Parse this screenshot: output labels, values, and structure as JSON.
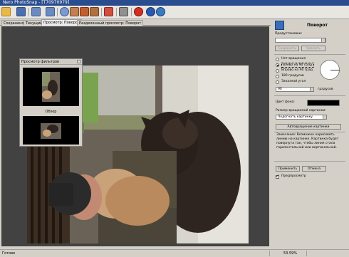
{
  "window": {
    "title": "Nero PhotoSnap - [T70970979]"
  },
  "tabs": [
    {
      "label": "Сохранено"
    },
    {
      "label": "Текущий"
    },
    {
      "label": "Просмотр: Поворот"
    },
    {
      "label": "Разделенный просмотр: Поворот"
    }
  ],
  "preview": {
    "title": "Просмотр фильтров",
    "caption": "Обзор"
  },
  "panel": {
    "title": "Поворот",
    "presets_label": "Предустановки:",
    "save_label": "Сохранить",
    "delete_label": "Удалить",
    "radios": [
      {
        "label": "Нет вращения",
        "selected": false
      },
      {
        "label": "Влево на 90 град.",
        "selected": true
      },
      {
        "label": "Вправо на 90 град.",
        "selected": false
      },
      {
        "label": "180 градусов",
        "selected": false
      },
      {
        "label": "Заказной угол",
        "selected": false
      }
    ],
    "angle_value": "90",
    "angle_unit": "градусов",
    "bg_color_label": "Цвет фона:",
    "bg_color": "#000000",
    "size_label": "Размер вращаемой картинки:",
    "size_value": "Подогнать картинку",
    "auto_label": "Автовращение картинки",
    "note": "Замечание: Возможно нарисовать линию на картинке. Картинка будет повернута так, чтобы линия стала горизонтальной или вертикальной.",
    "apply_label": "Применить",
    "cancel_label": "Отмена",
    "preview_check_label": "Предпросмотр",
    "preview_checked": true
  },
  "status": {
    "left": "Готово",
    "zoom": "53.59%"
  }
}
